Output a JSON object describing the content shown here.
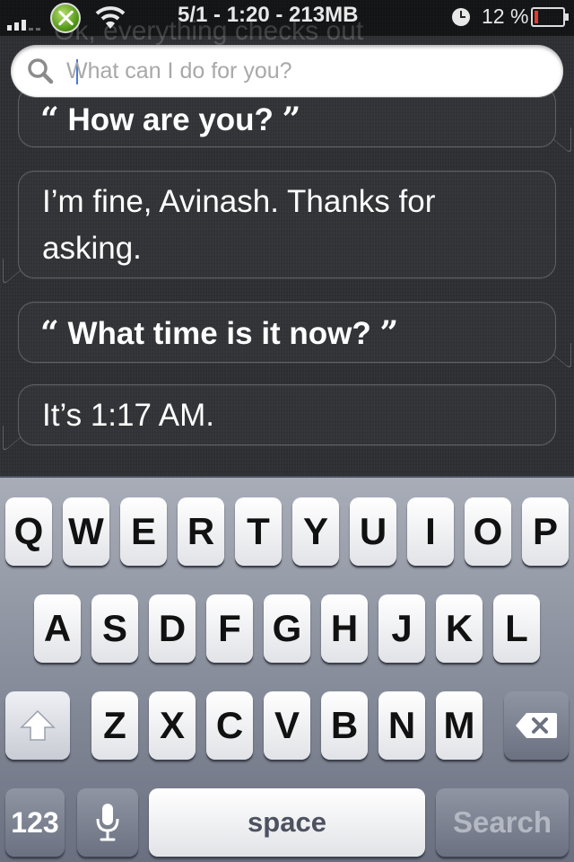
{
  "status_bar": {
    "ghost_text": "Ok, everything checks out",
    "info": "5/1 - 1:20 - 213MB",
    "battery_percent": "12 %",
    "battery_level": 0.12,
    "signal_icon": "signal-bars-icon",
    "carrier_icon": "xbox-icon",
    "wifi_icon": "wifi-icon",
    "clock_icon": "alarm-clock-icon",
    "battery_icon": "battery-icon",
    "battery_color": "#e23b2f"
  },
  "search": {
    "placeholder": "What can I do for you?",
    "value": "",
    "icon": "search-icon"
  },
  "conversation": {
    "items": [
      {
        "role": "user",
        "open_quote": "“",
        "text": "How are you?",
        "close_quote": "”"
      },
      {
        "role": "siri",
        "text": "I’m fine, Avinash. Thanks for asking."
      },
      {
        "role": "user",
        "open_quote": "“",
        "text": "What time is it now?",
        "close_quote": "”"
      },
      {
        "role": "siri",
        "text": "It’s 1:17 AM."
      }
    ]
  },
  "keyboard": {
    "row1": [
      "Q",
      "W",
      "E",
      "R",
      "T",
      "Y",
      "U",
      "I",
      "O",
      "P"
    ],
    "row2": [
      "A",
      "S",
      "D",
      "F",
      "G",
      "H",
      "J",
      "K",
      "L"
    ],
    "row3": [
      "Z",
      "X",
      "C",
      "V",
      "B",
      "N",
      "M"
    ],
    "numbers_label": "123",
    "space_label": "space",
    "search_label": "Search",
    "shift_icon": "shift-arrow-icon",
    "delete_icon": "backspace-icon",
    "mic_icon": "microphone-icon"
  }
}
